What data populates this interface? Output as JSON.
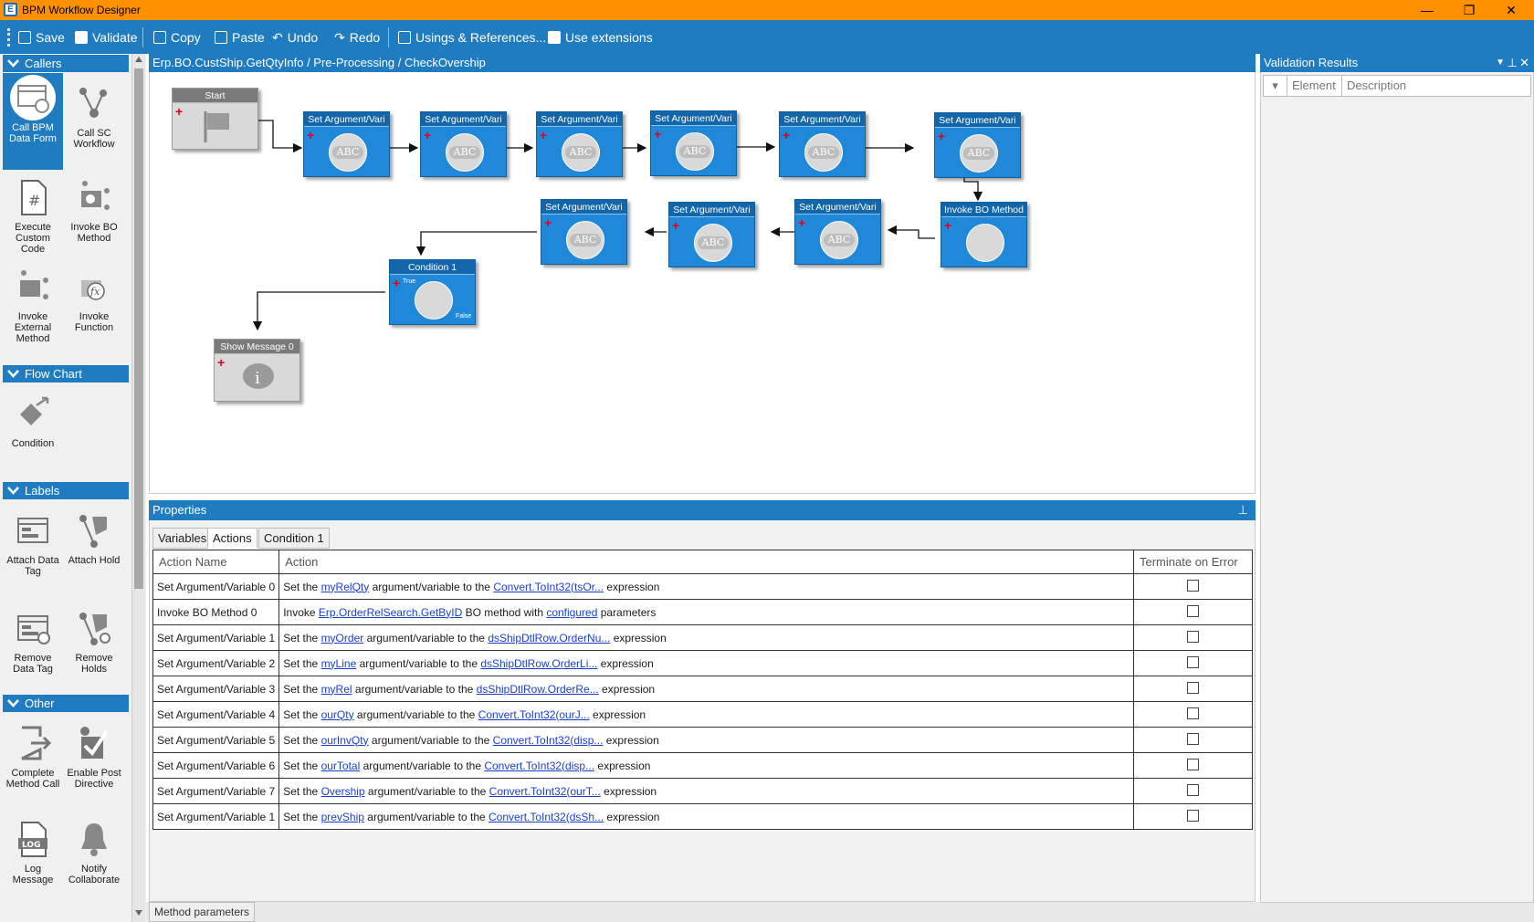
{
  "window": {
    "title": "BPM Workflow Designer",
    "app_icon": "E",
    "controls": [
      "—",
      "❐",
      "✕"
    ]
  },
  "toolbar": {
    "save": "Save",
    "validate": "Validate",
    "copy": "Copy",
    "paste": "Paste",
    "undo": "Undo",
    "redo": "Redo",
    "usings": "Usings & References...",
    "extensions": "Use extensions"
  },
  "toolbox": {
    "sections": {
      "callers": "Callers",
      "flowchart": "Flow Chart",
      "labels": "Labels",
      "other": "Other"
    },
    "tools": {
      "call_bpm_data_form": "Call BPM Data Form",
      "call_sc_workflow": "Call SC Workflow",
      "execute_custom_code": "Execute Custom Code",
      "invoke_bo_method": "Invoke BO Method",
      "invoke_external_method": "Invoke External Method",
      "invoke_function": "Invoke Function",
      "condition": "Condition",
      "attach_data_tag": "Attach Data Tag",
      "attach_hold": "Attach Hold",
      "remove_data_tag": "Remove Data Tag",
      "remove_holds": "Remove Holds",
      "complete_method_call": "Complete Method Call",
      "enable_post_directive": "Enable Post Directive",
      "log_message": "Log Message",
      "notify_collaborate": "Notify Collaborate"
    }
  },
  "breadcrumb": "Erp.BO.CustShip.GetQtyInfo / Pre-Processing / CheckOvership",
  "canvas": {
    "start": "Start",
    "set_arg": "Set Argument/Vari",
    "abc": "ABC",
    "invoke_bo": "Invoke BO Method",
    "condition": "Condition 1",
    "true_label": "True",
    "false_label": "False",
    "show_message": "Show Message 0"
  },
  "properties": {
    "title": "Properties",
    "tabs": [
      "Variables",
      "Actions",
      "Condition 1"
    ],
    "columns": {
      "name": "Action Name",
      "action": "Action",
      "terminate": "Terminate on Error"
    },
    "rows": [
      {
        "name": "Set Argument/Variable 0",
        "pre": "Set the ",
        "l1": "myRelQty",
        "mid": " argument/variable to the ",
        "l2": "Convert.ToInt32(tsOr...",
        "post": " expression"
      },
      {
        "name": "Invoke BO Method 0",
        "pre": "Invoke ",
        "l1": "Erp.OrderRelSearch.GetByID",
        "mid": " BO method with ",
        "l2": "configured",
        "post": " parameters"
      },
      {
        "name": "Set Argument/Variable 1",
        "pre": "Set the ",
        "l1": "myOrder",
        "mid": " argument/variable to the ",
        "l2": "dsShipDtlRow.OrderNu...",
        "post": " expression"
      },
      {
        "name": "Set Argument/Variable 2",
        "pre": "Set the ",
        "l1": "myLine",
        "mid": " argument/variable to the ",
        "l2": "dsShipDtlRow.OrderLi...",
        "post": " expression"
      },
      {
        "name": "Set Argument/Variable 3",
        "pre": "Set the ",
        "l1": "myRel",
        "mid": " argument/variable to the ",
        "l2": "dsShipDtlRow.OrderRe...",
        "post": " expression"
      },
      {
        "name": "Set Argument/Variable 4",
        "pre": "Set the ",
        "l1": "ourQty",
        "mid": " argument/variable to the ",
        "l2": "Convert.ToInt32(ourJ...",
        "post": " expression"
      },
      {
        "name": "Set Argument/Variable 5",
        "pre": "Set the ",
        "l1": "ourInvQty",
        "mid": " argument/variable to the ",
        "l2": "Convert.ToInt32(disp...",
        "post": " expression"
      },
      {
        "name": "Set Argument/Variable 6",
        "pre": "Set the ",
        "l1": "ourTotal",
        "mid": " argument/variable to the ",
        "l2": "Convert.ToInt32(disp...",
        "post": " expression"
      },
      {
        "name": "Set Argument/Variable 7",
        "pre": "Set the ",
        "l1": "Overship",
        "mid": " argument/variable to the ",
        "l2": "Convert.ToInt32(ourT...",
        "post": " expression"
      },
      {
        "name": "Set Argument/Variable 1",
        "pre": "Set the ",
        "l1": "prevShip",
        "mid": " argument/variable to the ",
        "l2": "Convert.ToInt32(dsSh...",
        "post": " expression"
      }
    ]
  },
  "bottom_tab": "Method parameters",
  "validation": {
    "title": "Validation Results",
    "col_element": "Element",
    "col_description": "Description"
  },
  "colors": {
    "accent": "#1f7cc1",
    "titlebar": "#ff9000",
    "node": "#1f88d9",
    "link": "#1a3ed0"
  }
}
